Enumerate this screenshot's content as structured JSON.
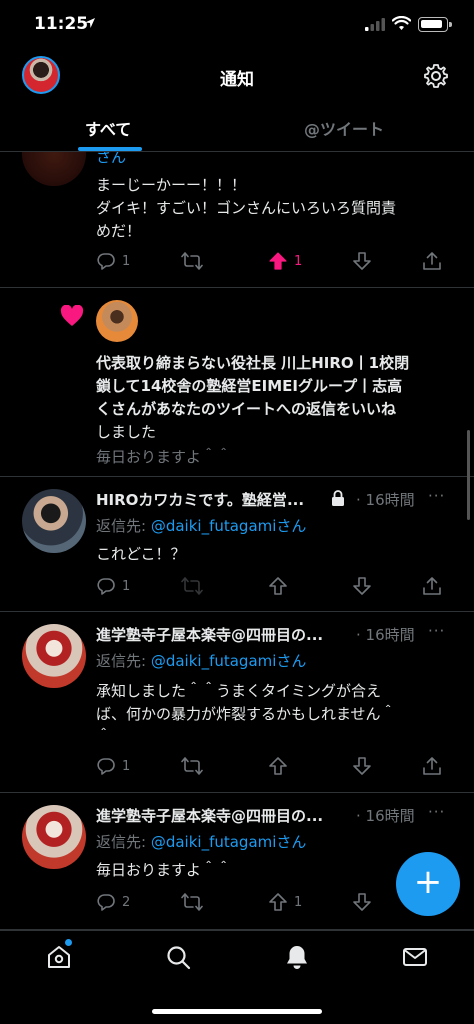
{
  "status_bar": {
    "time": "11:25"
  },
  "header": {
    "title": "通知"
  },
  "tabs": {
    "all": "すべて",
    "mentions": "@ツイート"
  },
  "colors": {
    "accent": "#1d9bf0",
    "like": "#f91880",
    "muted": "#71767b",
    "background": "#000000"
  },
  "feed": [
    {
      "partial_name": "さん",
      "text_lines": [
        "まーじーかーー！！！",
        "ダイキ！すごい！ゴンさんにいろいろ質問責",
        "めだ！"
      ],
      "counts": {
        "reply": "1",
        "retweet": "",
        "upvote": "1",
        "downvote": ""
      }
    },
    {
      "type": "like",
      "text_lines": [
        "代表取り締まらない役社長 川上HIRO丨1校閉",
        "鎖して14校舎の塾経営EIMEIグループ丨志高",
        "くさんがあなたのツイートへの返信をいいね",
        "しました"
      ],
      "quoted": "毎日おりますよ＾＾"
    },
    {
      "name": "HIROカワカミです。塾経営...",
      "time": "· 16時間",
      "reply_label": "返信先: ",
      "reply_handle": "@daiki_futagamiさん",
      "text_lines": [
        "これどこ！？"
      ],
      "counts": {
        "reply": "1",
        "retweet": "",
        "upvote": "",
        "downvote": ""
      }
    },
    {
      "name": "進学塾寺子屋本楽寺@四冊目の...",
      "time": "· 16時間",
      "reply_label": "返信先: ",
      "reply_handle": "@daiki_futagamiさん",
      "text_lines": [
        "承知しました＾＾うまくタイミングが合え",
        "ば、何かの暴力が炸裂するかもしれません＾",
        "＾"
      ],
      "counts": {
        "reply": "1",
        "retweet": "",
        "upvote": "",
        "downvote": ""
      }
    },
    {
      "name": "進学塾寺子屋本楽寺@四冊目の...",
      "time": "· 16時間",
      "reply_label": "返信先: ",
      "reply_handle": "@daiki_futagamiさん",
      "text_lines": [
        "毎日おりますよ＾＾"
      ],
      "counts": {
        "reply": "2",
        "retweet": "",
        "upvote": "1",
        "downvote": ""
      }
    }
  ],
  "more_label": "···",
  "fab_label": "+",
  "icons": [
    "location-arrow-icon",
    "cellular-signal-icon",
    "wifi-icon",
    "battery-icon",
    "settings-gear-icon",
    "heart-icon",
    "lock-icon",
    "reply-icon",
    "retweet-icon",
    "upvote-icon",
    "downvote-icon",
    "share-icon",
    "home-icon",
    "search-icon",
    "bell-icon",
    "mail-icon",
    "compose-icon"
  ]
}
